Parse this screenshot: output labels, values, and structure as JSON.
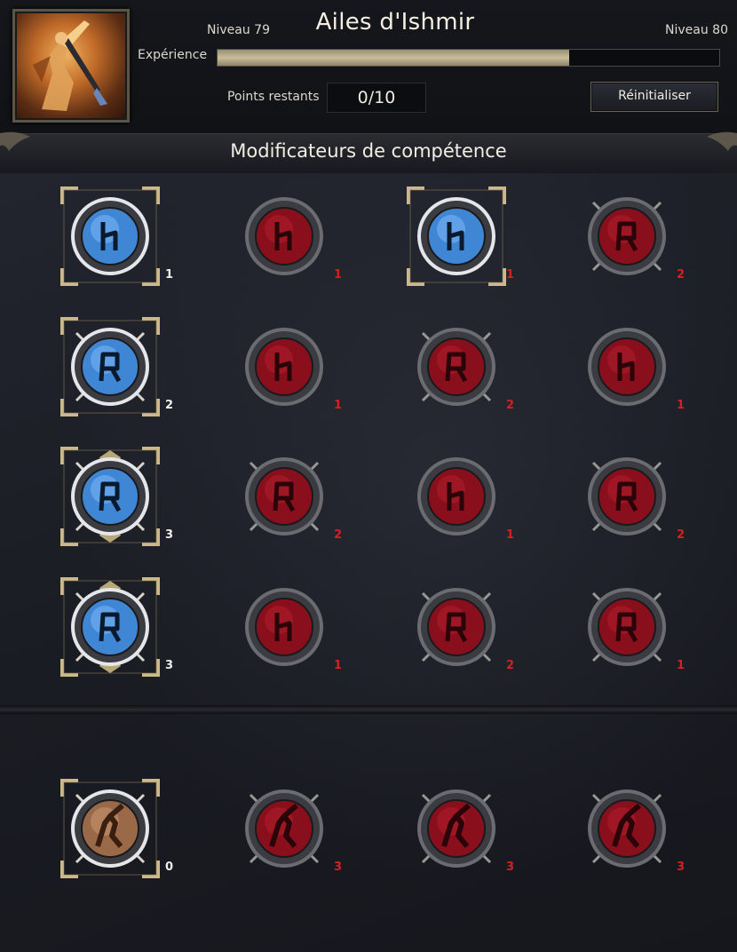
{
  "header": {
    "title": "Ailes d'Ishmir",
    "level_current": "Niveau 79",
    "level_next": "Niveau 80",
    "experience_label": "Expérience",
    "experience_fraction": 0.7,
    "points_label": "Points restants",
    "points_value": "0/10",
    "reset_label": "Réinitialiser",
    "portrait_icon": "winged-warrior-portrait"
  },
  "section": {
    "title": "Modificateurs de compétence"
  },
  "colors": {
    "active_blue": "#3f86d4",
    "locked_red": "#8a0f1c",
    "gold_frame": "#cbb98a",
    "number_red": "#d42020",
    "xp_fill": "#c9bd9a"
  },
  "rows": [
    {
      "cells": [
        {
          "kind": "active",
          "frame": "circle",
          "rune": "h-rune",
          "num": "1"
        },
        {
          "kind": "locked",
          "frame": "circle",
          "rune": "h-rune",
          "num": "1"
        },
        {
          "kind": "active",
          "frame": "circle",
          "rune": "h-rune",
          "num": "1"
        },
        {
          "kind": "locked",
          "frame": "spear",
          "rune": "a-rune",
          "num": "2"
        }
      ]
    },
    {
      "cells": [
        {
          "kind": "active",
          "frame": "spear",
          "rune": "a-rune",
          "num": "2"
        },
        {
          "kind": "locked",
          "frame": "circle",
          "rune": "h-rune",
          "num": "1"
        },
        {
          "kind": "locked",
          "frame": "spear",
          "rune": "a-rune",
          "num": "2"
        },
        {
          "kind": "locked",
          "frame": "circle",
          "rune": "h-rune",
          "num": "1"
        }
      ]
    },
    {
      "cells": [
        {
          "kind": "active",
          "frame": "crown",
          "rune": "a-rune",
          "num": "3"
        },
        {
          "kind": "locked",
          "frame": "spear",
          "rune": "a-rune",
          "num": "2"
        },
        {
          "kind": "locked",
          "frame": "circle",
          "rune": "h-rune",
          "num": "1"
        },
        {
          "kind": "locked",
          "frame": "spear",
          "rune": "a-rune",
          "num": "2"
        }
      ]
    },
    {
      "cells": [
        {
          "kind": "active",
          "frame": "crown",
          "rune": "a-rune",
          "num": "3"
        },
        {
          "kind": "locked",
          "frame": "circle",
          "rune": "h-rune",
          "num": "1"
        },
        {
          "kind": "locked",
          "frame": "spear",
          "rune": "a-rune",
          "num": "2"
        },
        {
          "kind": "locked",
          "frame": "spear",
          "rune": "a-rune",
          "num": "1"
        }
      ]
    },
    {
      "cells": [
        {
          "kind": "portrait",
          "frame": "spear",
          "rune": "warrior",
          "num": "0"
        },
        {
          "kind": "locked",
          "frame": "spear",
          "rune": "warrior",
          "num": "3"
        },
        {
          "kind": "locked",
          "frame": "spear",
          "rune": "warrior",
          "num": "3"
        },
        {
          "kind": "locked",
          "frame": "spear",
          "rune": "warrior",
          "num": "3"
        }
      ]
    }
  ]
}
